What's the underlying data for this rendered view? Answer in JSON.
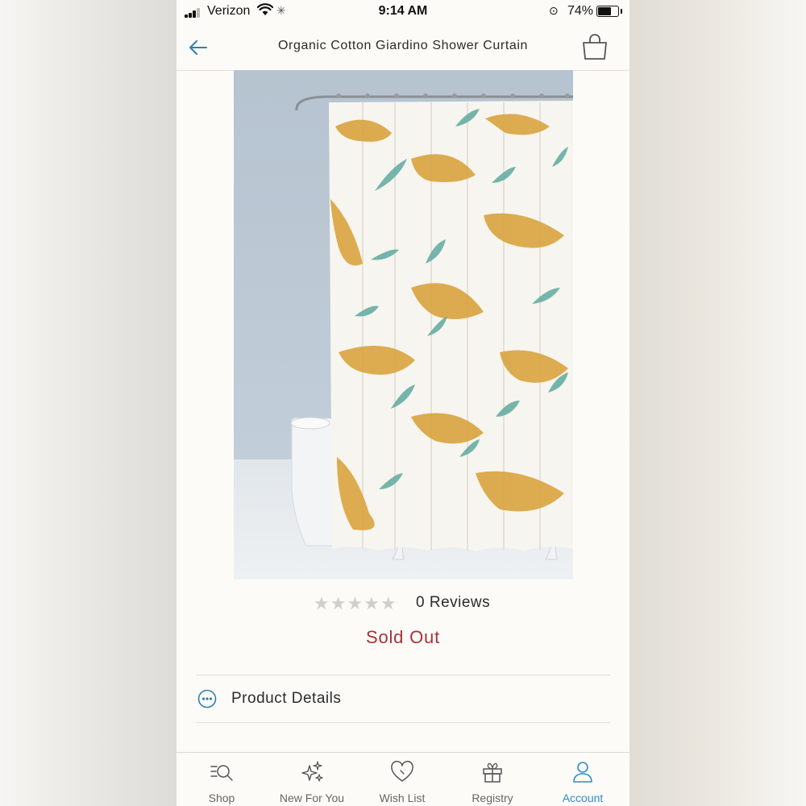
{
  "status_bar": {
    "carrier": "Verizon",
    "time": "9:14 AM",
    "battery": "74%",
    "battery_level": 0.74
  },
  "nav": {
    "title": "Organic Cotton Giardino Shower Curtain",
    "back_icon": "arrow-left-icon",
    "bag_icon": "shopping-bag-icon"
  },
  "product": {
    "image_description": "shower-curtain-photo",
    "rating": 0,
    "rating_max": 5,
    "reviews_label": "0 Reviews",
    "availability": "Sold Out"
  },
  "details": {
    "label": "Product Details",
    "icon": "more-dots-icon"
  },
  "tabs": [
    {
      "label": "Shop",
      "icon": "shop-search-icon"
    },
    {
      "label": "New For You",
      "icon": "sparkle-icon"
    },
    {
      "label": "Wish List",
      "icon": "heart-icon"
    },
    {
      "label": "Registry",
      "icon": "gift-icon"
    },
    {
      "label": "Account",
      "icon": "user-icon",
      "active": true
    }
  ],
  "colors": {
    "accent": "#2e8ec4",
    "sold_out": "#a8323a",
    "star_empty": "#cfcfcf"
  }
}
